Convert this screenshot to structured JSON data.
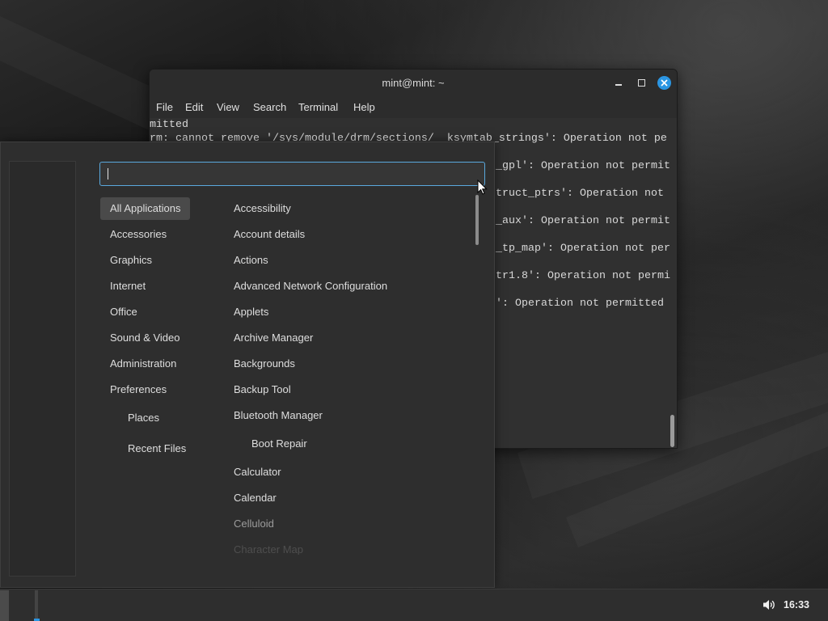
{
  "colors": {
    "accent": "#2b96e3",
    "search_border": "#5aa9de",
    "menu_bg": "#2e2e2e",
    "terminal_bg": "#303030",
    "selected_bg": "#4a4a4a",
    "text": "#dedede"
  },
  "icons": {
    "minimize": "minimize-icon",
    "maximize": "maximize-icon",
    "close": "close-icon",
    "volume": "volume-icon",
    "pointer": "mouse-pointer-icon"
  },
  "terminal": {
    "title": "mint@mint: ~",
    "menu": [
      "File",
      "Edit",
      "View",
      "Search",
      "Terminal",
      "Help"
    ],
    "lines": [
      "mitted",
      "rm: cannot remove '/sys/module/drm/sections/__ksymtab_strings': Operation not pe"
    ],
    "fragments": [
      "_gpl': Operation not permit",
      "truct_ptrs': Operation not",
      "_aux': Operation not permit",
      "_tp_map': Operation not per",
      "tr1.8': Operation not permi",
      "': Operation not permitted"
    ]
  },
  "app_menu": {
    "search": {
      "value": ""
    },
    "selected_category": "All Applications",
    "categories": [
      "All Applications",
      "Accessories",
      "Graphics",
      "Internet",
      "Office",
      "Sound & Video",
      "Administration",
      "Preferences"
    ],
    "places": [
      "Places",
      "Recent Files"
    ],
    "apps": [
      "Accessibility",
      "Account details",
      "Actions",
      "Advanced Network Configuration",
      "Applets",
      "Archive Manager",
      "Backgrounds",
      "Backup Tool",
      "Bluetooth Manager",
      "Boot Repair",
      "Calculator",
      "Calendar",
      "Celluloid",
      "Character Map"
    ]
  },
  "taskbar": {
    "clock": "16:33"
  }
}
